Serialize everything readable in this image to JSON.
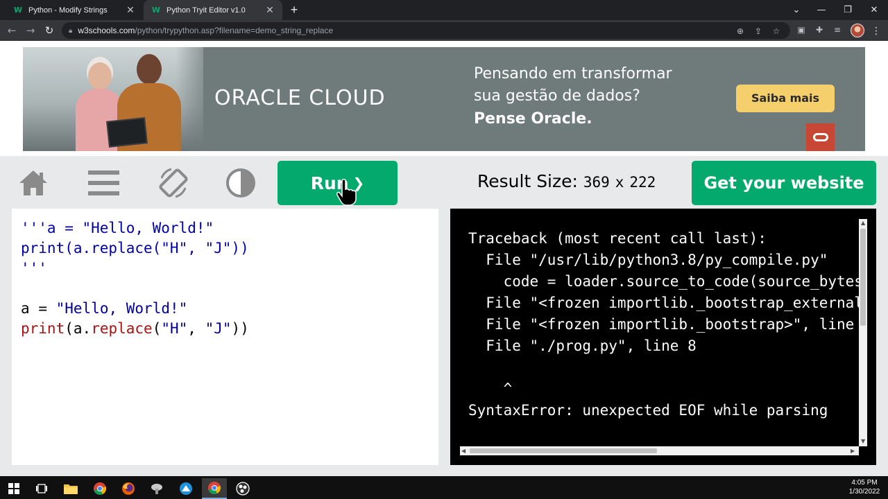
{
  "browser": {
    "tabs": [
      {
        "favicon": "W",
        "title": "Python - Modify Strings",
        "active": false
      },
      {
        "favicon": "W",
        "title": "Python Tryit Editor v1.0",
        "active": true
      }
    ],
    "new_tab": "+",
    "url_host": "w3schools.com",
    "url_path": "/python/trypython.asp?filename=demo_string_replace"
  },
  "ad": {
    "brand": "ORACLE CLOUD",
    "line1": "Pensando em transformar",
    "line2": "sua gestão de dados?",
    "line3": "Pense Oracle.",
    "cta": "Saiba mais"
  },
  "toolbar": {
    "run_label": "Run",
    "run_chevron": "❯",
    "result_size_label": "Result Size:",
    "result_width": "369",
    "result_x": "x",
    "result_height": "222",
    "get_website_label": "Get your website"
  },
  "editor": {
    "lines": [
      "'''a = \"Hello, World!\"",
      "print(a.replace(\"H\", \"J\"))",
      "'''",
      "",
      "a = \"Hello, World!\"",
      "print(a.replace(\"H\", \"J\"))"
    ]
  },
  "output": {
    "text": "Traceback (most recent call last):\n  File \"/usr/lib/python3.8/py_compile.py\"\n    code = loader.source_to_code(source_bytes\n  File \"<frozen importlib._bootstrap_external>\n  File \"<frozen importlib._bootstrap>\", line\n  File \"./prog.py\", line 8\n\n    ^\nSyntaxError: unexpected EOF while parsing"
  },
  "taskbar": {
    "time": "4:05 PM",
    "date": "1/30/2022"
  },
  "colors": {
    "w3_green": "#04aa6d",
    "page_bg": "#e7e9eb",
    "string_blue": "#000099",
    "function_red": "#aa1111"
  }
}
